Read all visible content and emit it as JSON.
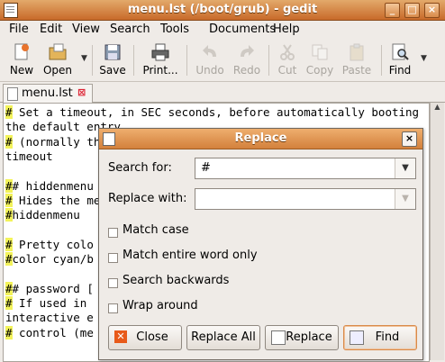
{
  "window": {
    "title": "menu.lst (/boot/grub) - gedit"
  },
  "menubar": [
    "File",
    "Edit",
    "View",
    "Search",
    "Tools",
    "Documents",
    "Help"
  ],
  "toolbar": {
    "new": "New",
    "open": "Open",
    "save": "Save",
    "print": "Print...",
    "undo": "Undo",
    "redo": "Redo",
    "cut": "Cut",
    "copy": "Copy",
    "paste": "Paste",
    "find": "Find"
  },
  "tab": {
    "label": "menu.lst"
  },
  "editor": {
    "lines": [
      "# Set a timeout, in SEC seconds, before automatically booting",
      "the default entry",
      "# (normally th",
      "timeout",
      "",
      "## hiddenmenu",
      "# Hides the me",
      "#hiddenmenu",
      "",
      "# Pretty colo",
      "#color cyan/b",
      "",
      "## password [",
      "# If used in",
      "interactive e",
      "# control (me"
    ]
  },
  "dialog": {
    "title": "Replace",
    "search_label": "Search for:",
    "search_value": "#",
    "replace_label": "Replace with:",
    "replace_value": "",
    "options": [
      "Match case",
      "Match entire word only",
      "Search backwards",
      "Wrap around"
    ],
    "buttons": {
      "close": "Close",
      "replace_all": "Replace All",
      "replace": "Replace",
      "find": "Find"
    }
  },
  "colors": {
    "titlebar": "#d3813c",
    "highlight": "#f3f35a"
  }
}
